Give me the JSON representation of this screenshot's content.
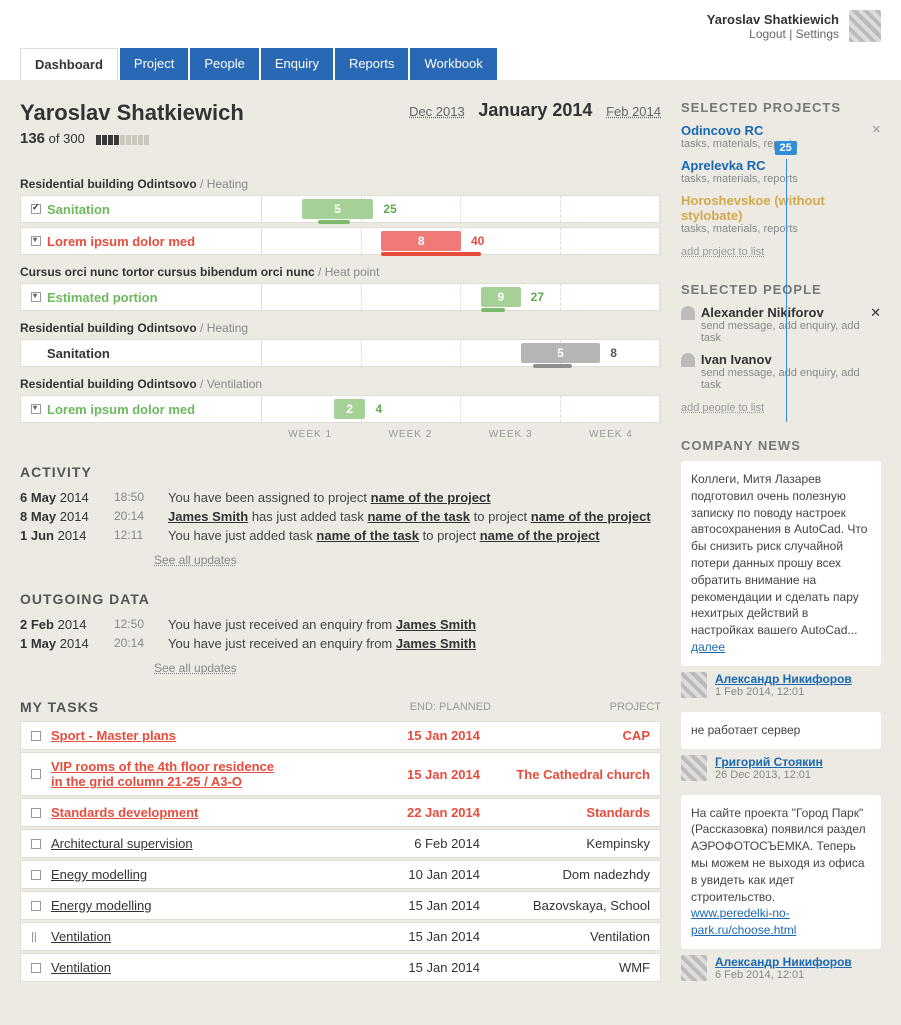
{
  "header": {
    "user_name": "Yaroslav Shatkiewich",
    "logout": "Logout",
    "settings": "Settings"
  },
  "tabs": [
    "Dashboard",
    "Project",
    "People",
    "Enquiry",
    "Reports",
    "Workbook"
  ],
  "active_tab": 0,
  "dash": {
    "name": "Yaroslav Shatkiewich",
    "count_current": "136",
    "count_of": "of",
    "count_total": "300",
    "month_prev": "Dec 2013",
    "month_cur": "January 2014",
    "month_next": "Feb 2014",
    "today": "25"
  },
  "gantt": {
    "sections": [
      {
        "title": "Residential building Odintsovo",
        "sub": "Heating",
        "rows": [
          {
            "label": "Sanitation",
            "color": "green",
            "chk": "done",
            "bar_val": "5",
            "ext_val": "25"
          },
          {
            "label": "Lorem ipsum dolor med",
            "color": "red",
            "chk": "arrow",
            "bar_val": "8",
            "ext_val": "40"
          }
        ]
      },
      {
        "title": "Cursus orci nunc tortor cursus bibendum  orci nunc",
        "sub": "Heat point",
        "rows": [
          {
            "label": "Estimated portion",
            "color": "green",
            "chk": "arrow",
            "bar_val": "9",
            "ext_val": "27"
          }
        ]
      },
      {
        "title": "Residential building Odintsovo",
        "sub": "Heating",
        "rows": [
          {
            "label": "Sanitation",
            "color": "gray",
            "chk": "",
            "bar_val": "5",
            "ext_val": "8"
          }
        ]
      },
      {
        "title": "Residential building Odintsovo",
        "sub": "Ventilation",
        "rows": [
          {
            "label": "Lorem ipsum dolor med",
            "color": "green",
            "chk": "arrow",
            "bar_val": "2",
            "ext_val": "4"
          }
        ]
      }
    ],
    "weeks": [
      "WEEK 1",
      "WEEK 2",
      "WEEK 3",
      "WEEK 4"
    ]
  },
  "activity": {
    "title": "ACTIVITY",
    "rows": [
      {
        "date": "6 May",
        "year": "2014",
        "time": "18:50",
        "text_pre": "You have been assigned to project ",
        "link": "name of the project",
        "text_post": ""
      },
      {
        "date": "8 May",
        "year": "2014",
        "time": "20:14",
        "text_pre": "",
        "person": "James Smith",
        "text_mid": " has just added task ",
        "link": "name of the task",
        "text_post": " to  project ",
        "link2": "name of the project"
      },
      {
        "date": "1 Jun",
        "year": "2014",
        "time": "12:11",
        "text_pre": "You have just added task ",
        "link": "name of the task",
        "text_post": " to project ",
        "link2": "name of the project"
      }
    ],
    "see_all": "See all updates"
  },
  "outgoing": {
    "title": "OUTGOING DATA",
    "rows": [
      {
        "date": "2 Feb",
        "year": "2014",
        "time": "12:50",
        "text": "You have just received an enquiry from ",
        "link": "James Smith"
      },
      {
        "date": "1 May",
        "year": "2014",
        "time": "20:14",
        "text": "You have just received an enquiry from ",
        "link": "James Smith"
      }
    ],
    "see_all": "See all updates"
  },
  "tasks": {
    "title": "MY TASKS",
    "col_end": "END: PLANNED",
    "col_proj": "PROJECT",
    "rows": [
      {
        "name": "Sport - Master plans",
        "date": "15 Jan 2014",
        "proj": "CAP",
        "hl": true,
        "chk": ""
      },
      {
        "name": "VIP rooms of the 4th floor residence\nin the grid column 21-25 / A3-O",
        "date": "15 Jan 2014",
        "proj": "The Cathedral church",
        "hl": true,
        "chk": ""
      },
      {
        "name": "Standards development",
        "date": "22 Jan 2014",
        "proj": "Standards",
        "hl": true,
        "chk": ""
      },
      {
        "name": "Architectural supervision",
        "date": "6 Feb 2014",
        "proj": "Kempinsky",
        "hl": false,
        "chk": ""
      },
      {
        "name": "Enegy modelling",
        "date": "10 Jan 2014",
        "proj": "Dom nadezhdy",
        "hl": false,
        "chk": ""
      },
      {
        "name": "Energy modelling",
        "date": "15 Jan 2014",
        "proj": "Bazovskaya, School",
        "hl": false,
        "chk": ""
      },
      {
        "name": "Ventilation",
        "date": "15 Jan 2014",
        "proj": "Ventilation",
        "hl": false,
        "chk": "pause"
      },
      {
        "name": "Ventilation",
        "date": "15 Jan 2014",
        "proj": "WMF",
        "hl": false,
        "chk": ""
      }
    ]
  },
  "side_projects": {
    "title": "SELECTED PROJECTS",
    "items": [
      {
        "name": "Odincovo RC",
        "sub": "tasks, materials, reports",
        "x": true
      },
      {
        "name": "Aprelevka RC",
        "sub": "tasks, materials, reports"
      },
      {
        "name": "Horoshevskoe (without stylobate)",
        "sub": "tasks, materials, reports",
        "faded": true
      }
    ],
    "add": "add project to list"
  },
  "side_people": {
    "title": "SELECTED PEOPLE",
    "items": [
      {
        "name": "Alexander Nikiforov",
        "sub": "send message, add enquiry, add task",
        "x": true
      },
      {
        "name": "Ivan Ivanov",
        "sub": "send message, add enquiry, add task"
      }
    ],
    "add": "add people to list"
  },
  "news": {
    "title": "COMPANY NEWS",
    "items": [
      {
        "text": "Коллеги, Митя Лазарев подготовил очень полезную записку по поводу настроек автосохранения в AutoCad. Что бы снизить риск случайной потери данных прошу всех обратить внимание на рекомендации и сделать пару нехитрых действий в настройках вашего AutoCad...",
        "more": "далее",
        "author": "Александр Никифоров",
        "date": "1 Feb 2014, 12:01"
      },
      {
        "text": "не работает сервер",
        "author": "Григорий Стоякин",
        "date": "26 Dec 2013, 12:01"
      },
      {
        "text": "На сайте проекта \"Город Парк\" (Рассказовка) появился раздел АЭРОФОТОСЪЕМКА. Теперь мы можем не выходя из офиса в увидеть как идет строительство.",
        "link": "www.peredelki-no-park.ru/choose.html",
        "author": "Александр Никифоров",
        "date": "6 Feb 2014, 12:01"
      }
    ]
  }
}
